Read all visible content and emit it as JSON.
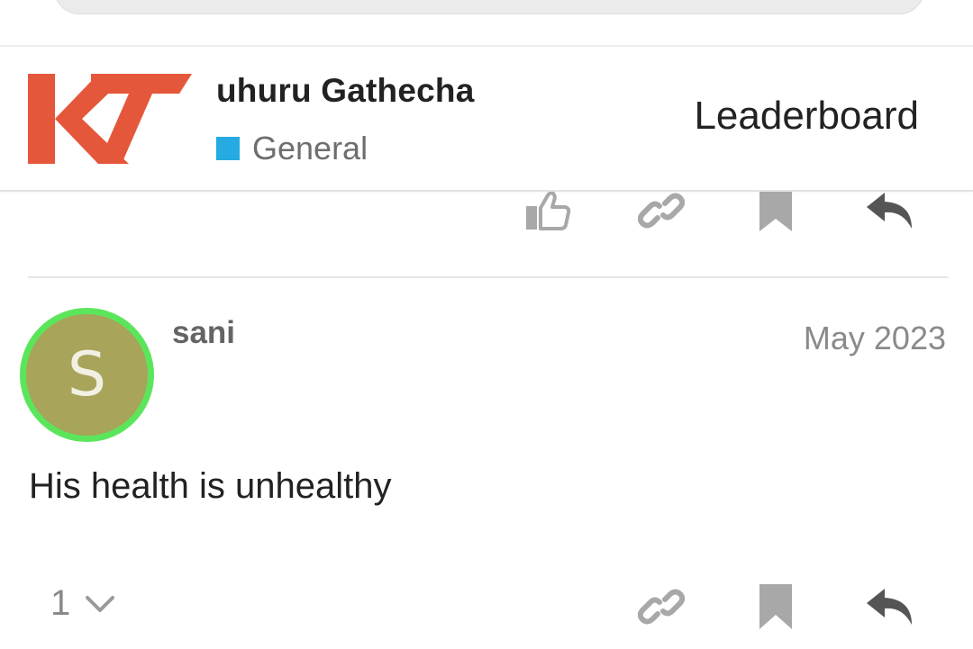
{
  "header": {
    "topic_title": "uhuru Gathecha",
    "category": "General",
    "category_color": "#25aae1",
    "leaderboard_label": "Leaderboard",
    "logo_color": "#e4573a"
  },
  "prev_post_actions": {
    "icons": [
      "like-icon",
      "link-icon",
      "bookmark-icon",
      "reply-icon"
    ]
  },
  "post": {
    "avatar_letter": "S",
    "avatar_color": "#a8a45a",
    "avatar_ring_color": "#5be55b",
    "username": "sani",
    "date": "May 2023",
    "body": "His health is unhealthy",
    "reply_count": "1"
  },
  "colors": {
    "icon_gray": "#a8a8a8",
    "reply_icon": "#555555"
  }
}
